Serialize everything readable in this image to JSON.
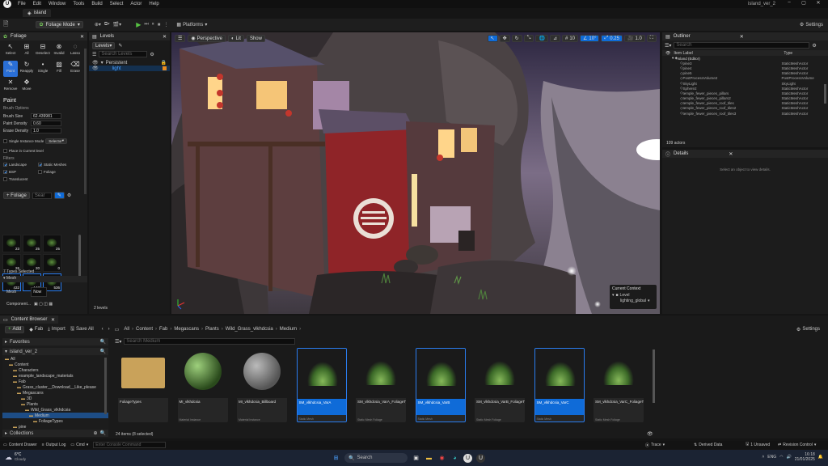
{
  "menubar": {
    "items": [
      "File",
      "Edit",
      "Window",
      "Tools",
      "Build",
      "Select",
      "Actor",
      "Help"
    ],
    "project_tab": "island",
    "window_title": "island_ver_2"
  },
  "toolbar": {
    "mode": "Foliage Mode",
    "platforms": "Platforms",
    "settings": "Settings"
  },
  "foliage_panel": {
    "tab": "Foliage",
    "tools": [
      "Select",
      "All",
      "Deselect",
      "Invalid",
      "Lasso",
      "Paint",
      "Reapply",
      "Single",
      "Fill",
      "Erase",
      "Remove",
      "Move"
    ],
    "section_paint": "Paint",
    "brush_options": "Brush Options",
    "brush_size_label": "Brush Size",
    "brush_size": "62.439981",
    "paint_density_label": "Paint Density",
    "paint_density": "0.60",
    "erase_density_label": "Erase Density",
    "erase_density": "1.0",
    "single_instance": "Single Instance Mode",
    "select_placeholder": "Selector",
    "place_current_level": "Place in Current level",
    "filters": "Filters",
    "filter_landscape": "Landscape",
    "filter_static_meshes": "Static Meshes",
    "filter_bsp": "BSP",
    "filter_foliage": "Foliage",
    "filter_translucent": "Translucent",
    "add_foliage": "+ Foliage",
    "search_placeholder": "Sear",
    "grid_counts": [
      "23",
      "25",
      "25",
      "26",
      "20",
      "0",
      "432",
      "147",
      "536"
    ],
    "types_selected": "7 Types Selected",
    "mesh_section": "Mesh",
    "mesh_label": "Mesh",
    "mesh_value": "Now",
    "component_label": "Component..."
  },
  "levels_panel": {
    "tab": "Levels",
    "levels_btn": "Levels",
    "search_placeholder": "Search Levels",
    "persistent": "Persistent",
    "light": "light",
    "count": "2 levels"
  },
  "viewport": {
    "perspective": "Perspective",
    "lit": "Lit",
    "show": "Show",
    "grid_value": "10",
    "angle_value": "10°",
    "scale_value": "0.25",
    "speed_value": "1.0",
    "current_context": "Current Context",
    "level_label": "Level",
    "level_value": "lighting_global"
  },
  "outliner": {
    "tab": "Outliner",
    "search_placeholder": "Search",
    "col_label": "Item Label",
    "col_type": "Type",
    "root": "island (Editor)",
    "rows": [
      {
        "label": "pine3",
        "type": "StaticMeshActor"
      },
      {
        "label": "pine4",
        "type": "StaticMeshActor"
      },
      {
        "label": "pine5",
        "type": "StaticMeshActor"
      },
      {
        "label": "PostProcessVolume2",
        "type": "PostProcessVolume"
      },
      {
        "label": "SkyLight",
        "type": "SkyLight"
      },
      {
        "label": "Sphere2",
        "type": "StaticMeshActor"
      },
      {
        "label": "temple_fewer_pieces_pillars",
        "type": "StaticMeshActor"
      },
      {
        "label": "temple_fewer_pieces_pillars2",
        "type": "StaticMeshActor"
      },
      {
        "label": "temple_fewer_pieces_roof_tiles",
        "type": "StaticMeshActor"
      },
      {
        "label": "temple_fewer_pieces_roof_tiles2",
        "type": "StaticMeshActor"
      },
      {
        "label": "temple_fewer_pieces_roof_tiles3",
        "type": "StaticMeshActor"
      }
    ],
    "count": "109 actors"
  },
  "details": {
    "tab": "Details",
    "empty": "Select an object to view details."
  },
  "content_browser": {
    "tab": "Content Browser",
    "add": "Add",
    "fab": "Fab",
    "import": "Import",
    "save_all": "Save All",
    "breadcrumb": [
      "All",
      "Content",
      "Fab",
      "Megascans",
      "Plants",
      "Wild_Grass_vlkhdcsia",
      "Medium"
    ],
    "settings": "Settings",
    "favorites": "Favorites",
    "project": "island_ver_2",
    "search_placeholder": "Search Medium",
    "tree": [
      {
        "label": "All",
        "indent": 0
      },
      {
        "label": "Content",
        "indent": 1
      },
      {
        "label": "Characters",
        "indent": 2
      },
      {
        "label": "example_landscape_materials",
        "indent": 2
      },
      {
        "label": "Fab",
        "indent": 2
      },
      {
        "label": "Grass_cluster__Download__Like_please",
        "indent": 3
      },
      {
        "label": "Megascans",
        "indent": 3
      },
      {
        "label": "3D",
        "indent": 4
      },
      {
        "label": "Plants",
        "indent": 4
      },
      {
        "label": "Wild_Grass_vlkhdcsia",
        "indent": 5
      },
      {
        "label": "Medium",
        "indent": 6
      },
      {
        "label": "FoliageTypes",
        "indent": 7
      },
      {
        "label": "pine",
        "indent": 2
      }
    ],
    "collections": "Collections",
    "status": "24 items (8 selected)",
    "assets": [
      {
        "name": "FoliageTypes",
        "type": ""
      },
      {
        "name": "MI_vlkhdcsia",
        "type": "Material Instance"
      },
      {
        "name": "MI_vlkhdcsia_Billboard",
        "type": "Material Instance"
      },
      {
        "name": "SM_vlkhdcsia_VarA",
        "type": "Static Mesh"
      },
      {
        "name": "SM_vlkhdcsia_VarA_FoliageType",
        "type": "Static Mesh Foliage"
      },
      {
        "name": "SM_vlkhdcsia_VarB",
        "type": "Static Mesh"
      },
      {
        "name": "SM_vlkhdcsia_VarB_FoliageType",
        "type": "Static Mesh Foliage"
      },
      {
        "name": "SM_vlkhdcsia_VarC",
        "type": "Static Mesh"
      },
      {
        "name": "SM_vlkhdcsia_VarC_FoliageType",
        "type": "Static Mesh Foliage"
      }
    ]
  },
  "statusbar": {
    "content_drawer": "Content Drawer",
    "output_log": "Output Log",
    "cmd": "Cmd",
    "console_placeholder": "Enter Console Command",
    "trace": "Trace",
    "derived_data": "Derived Data",
    "unsaved": "1 Unsaved",
    "revision_control": "Revision Control"
  },
  "taskbar": {
    "weather_temp": "6°C",
    "weather_desc": "Cloudy",
    "search": "Search",
    "lang": "ENG",
    "time": "16:18",
    "date": "21/01/2025"
  },
  "colors": {
    "accent": "#0f6bd8",
    "panel": "#1c1c1c",
    "folder": "#c9a25a"
  }
}
